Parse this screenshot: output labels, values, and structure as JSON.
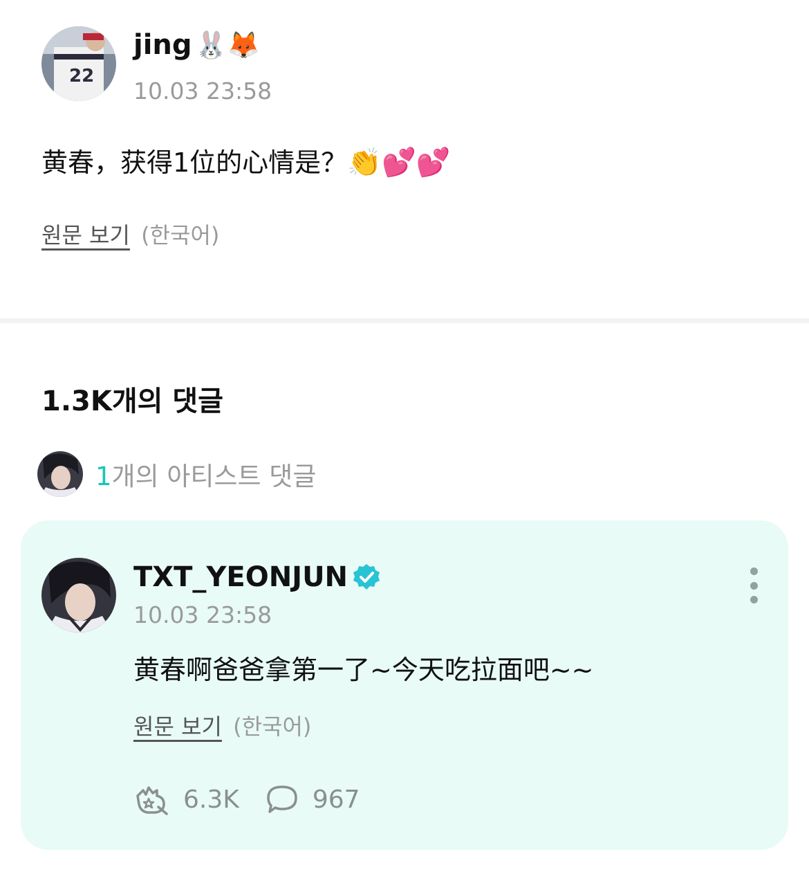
{
  "post": {
    "author_name": "jing",
    "author_emojis": "🐰🦊",
    "time": "10.03 23:58",
    "text": "黄春，获得1位的心情是？",
    "text_emojis": "👏💕💕",
    "view_original_label": "원문 보기",
    "original_language": "(한국어)"
  },
  "comments": {
    "count_label": "1.3K개의 댓글",
    "artist_count_num": "1",
    "artist_count_suffix": "개의 아티스트 댓글"
  },
  "artist_comment": {
    "author_name": "TXT_YEONJUN",
    "time": "10.03 23:58",
    "text": "黄春啊爸爸拿第一了~今天吃拉面吧~~",
    "view_original_label": "원문 보기",
    "original_language": "(한국어)",
    "likes": "6.3K",
    "replies": "967"
  },
  "colors": {
    "accent": "#19c6b8",
    "card_bg": "#e8fbf6",
    "muted_text": "#9a9a9a"
  },
  "icons": [
    "verified-badge-icon",
    "more-vertical-icon",
    "cheer-icon",
    "comment-bubble-icon"
  ]
}
